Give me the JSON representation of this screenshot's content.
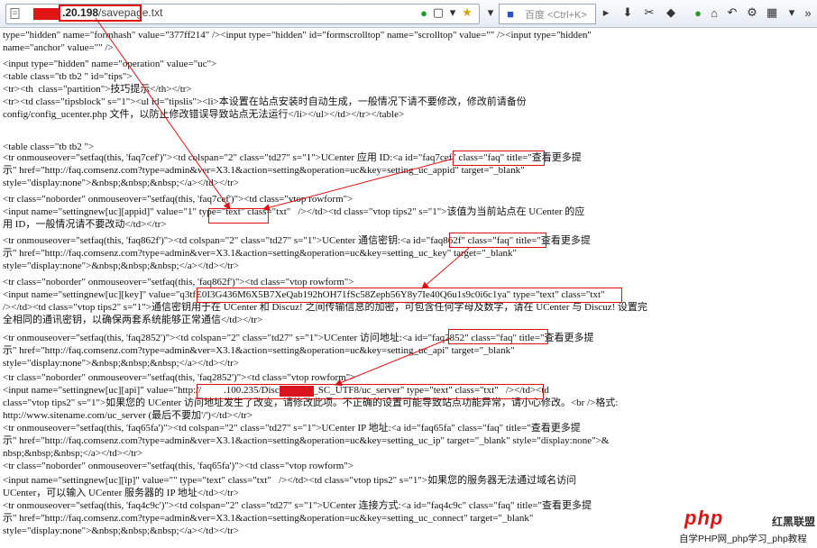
{
  "browser": {
    "url_host": ".20.198",
    "url_path": "/savepage.txt",
    "search_placeholder": "百度 <Ctrl+K>",
    "icons": [
      "page-icon",
      "go-icon",
      "home-icon",
      "bookmark-icon",
      "star-icon",
      "dropdown-icon",
      "baidu-icon",
      "down-arrow-icon",
      "screenshot-icon",
      "addon-icon",
      "back-icon",
      "forward-icon",
      "home-icon",
      "undo-icon",
      "settings-icon",
      "grid-icon",
      "more-icon"
    ]
  },
  "source_lines": [
    "type=\"hidden\" name=\"formhash\" value=\"377ff214\" /><input type=\"hidden\" id=\"formscrolltop\" name=\"scrolltop\" value=\"\" /><input type=\"hidden\"",
    "name=\"anchor\" value=\"\" />",
    "<input type=\"hidden\" name=\"operation\" value=\"uc\">",
    "<table class=\"tb tb2 \" id=\"tips\">",
    "<tr><th  class=\"partition\">技巧提示</th></tr>",
    "<tr><td class=\"tipsblock\" s=\"1\"><ul id=\"tipslis\"><li>本设置在站点安装时自动生成，一般情况下请不要修改，修改前请备份",
    "config/config_ucenter.php 文件，以防止修改错误导致站点无法运行</li></ul></td></tr></table>",
    "",
    "<table class=\"tb tb2 \">",
    "<tr onmouseover=\"setfaq(this, 'faq7cef')\"><td colspan=\"2\" class=\"td27\" s=\"1\">UCenter 应用 ID:<a id=\"faq7cef\" class=\"faq\" title=\"查看更多提",
    "示\" href=\"http://faq.comsenz.com?type=admin&ver=X3.1&action=setting&operation=uc&key=setting_uc_appid\" target=\"_blank\"",
    "style=\"display:none\">&nbsp;&nbsp;&nbsp;</a></td></tr>",
    "<tr class=\"noborder\" onmouseover=\"setfaq(this, 'faq7cef')\"><td class=\"vtop rowform\">",
    "<input name=\"settingnew[uc][appid]\" value=\"1\" type=\"text\" class=\"txt\"   /></td><td class=\"vtop tips2\" s=\"1\">该值为当前站点在 UCenter 的应",
    "用 ID，一般情况请不要改动</td></tr>",
    "<tr onmouseover=\"setfaq(this, 'faq862f')\"><td colspan=\"2\" class=\"td27\" s=\"1\">UCenter 通信密钥:<a id=\"faq862f\" class=\"faq\" title=\"查看更多提",
    "示\" href=\"http://faq.comsenz.com?type=admin&ver=X3.1&action=setting&operation=uc&key=setting_uc_key\" target=\"_blank\"",
    "style=\"display:none\">&nbsp;&nbsp;&nbsp;</a></td></tr>",
    "<tr class=\"noborder\" onmouseover=\"setfaq(this, 'faq862f')\"><td class=\"vtop rowform\">",
    "<input name=\"settingnew[uc][key]\" value=\"q3tfE0I3G436M6X5B7XeQab192hOH71fSc58Zepb56Y8y7Ie40Q6u1s9c0i6c1ya\" type=\"text\" class=\"txt\"",
    "/></td><td class=\"vtop tips2\" s=\"1\">通信密钥用于在 UCenter 和 Discuz! 之间传输信息的加密，可包含任何字母及数字，请在 UCenter 与 Discuz! 设置完",
    "全相同的通讯密钥，以确保两套系统能够正常通信</td></tr>",
    "<tr onmouseover=\"setfaq(this, 'faq2852')\"><td colspan=\"2\" class=\"td27\" s=\"1\">UCenter 访问地址:<a id=\"faq2852\" class=\"faq\" title=\"查看更多提",
    "示\" href=\"http://faq.comsenz.com?type=admin&ver=X3.1&action=setting&operation=uc&key=setting_uc_api\" target=\"_blank\"",
    "style=\"display:none\">&nbsp;&nbsp;&nbsp;</a></td></tr>",
    "<tr class=\"noborder\" onmouseover=\"setfaq(this, 'faq2852')\"><td class=\"vtop rowform\">",
    "<input name=\"settingnew[uc][api]\" value=\"http://         .100.235/Discuz_X3.1_SC_UTF8/uc_server\" type=\"text\" class=\"txt\"   /></td><td",
    "class=\"vtop tips2\" s=\"1\">如果您的 UCenter 访问地址发生了改变，请修改此项。不正确的设置可能导致站点功能异常，请小心修改。<br />格式:",
    "http://www.sitename.com/uc_server (最后不要加'/')</td></tr>",
    "<tr onmouseover=\"setfaq(this, 'faq65fa')\"><td colspan=\"2\" class=\"td27\" s=\"1\">UCenter IP 地址:<a id=\"faq65fa\" class=\"faq\" title=\"查看更多提",
    "示\" href=\"http://faq.comsenz.com?type=admin&ver=X3.1&action=setting&operation=uc&key=setting_uc_ip\" target=\"_blank\" style=\"display:none\">&",
    "nbsp;&nbsp;&nbsp;</a></td></tr>",
    "<tr class=\"noborder\" onmouseover=\"setfaq(this, 'faq65fa')\"><td class=\"vtop rowform\">",
    "<input name=\"settingnew[uc][ip]\" value=\"\" type=\"text\" class=\"txt\"   /></td><td class=\"vtop tips2\" s=\"1\">如果您的服务器无法通过域名访问",
    "UCenter，可以输入 UCenter 服务器的 IP 地址</td></tr>",
    "<tr onmouseover=\"setfaq(this, 'faq4c9c')\"><td colspan=\"2\" class=\"td27\" s=\"1\">UCenter 连接方式:<a id=\"faq4c9c\" class=\"faq\" title=\"查看更多提",
    "示\" href=\"http://faq.comsenz.com?type=admin&ver=X3.1&action=setting&operation=uc&key=setting_uc_connect\" target=\"_blank\"",
    "style=\"display:none\">&nbsp;&nbsp;&nbsp;</a></td></tr>"
  ],
  "watermark": {
    "logo_text": "php",
    "brand_text": "红黑联盟",
    "caption": "自学PHP网_php学习_php教程"
  },
  "colors": {
    "highlight": "#dd1111",
    "redaction": "#d9141c"
  }
}
